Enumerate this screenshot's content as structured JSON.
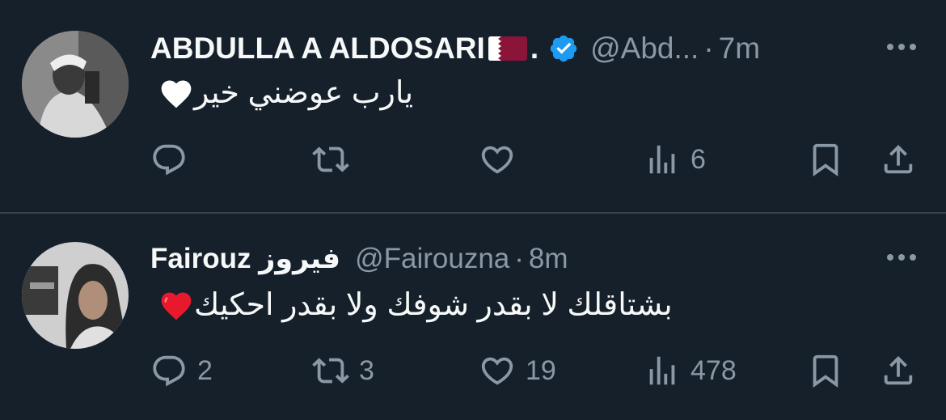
{
  "tweets": [
    {
      "name": "ABDULLA A ALDOSARI",
      "name_suffix": ".",
      "flag": "qatar-flag",
      "verified": true,
      "handle": "@Abd...",
      "separator": "·",
      "time": "7m",
      "text": "يارب عوضني خير",
      "emoji": "white-heart-emoji",
      "counts": {
        "replies": "",
        "retweets": "",
        "likes": "",
        "views": "6"
      }
    },
    {
      "name": "Fairouz فيروز",
      "handle": "@Fairouzna",
      "separator": "·",
      "time": "8m",
      "text": "بشتاقلك لا بقدر شوفك ولا بقدر احكيك",
      "emoji": "red-heart-emoji",
      "counts": {
        "replies": "2",
        "retweets": "3",
        "likes": "19",
        "views": "478"
      }
    }
  ],
  "colors": {
    "background": "#15202b",
    "text": "#f7f9f9",
    "muted": "#8b98a5",
    "divider": "#38444d",
    "verified": "#1d9bf0"
  },
  "icons": [
    "more-icon",
    "reply-icon",
    "retweet-icon",
    "like-icon",
    "views-icon",
    "bookmark-icon",
    "share-icon",
    "verified-badge-icon"
  ]
}
